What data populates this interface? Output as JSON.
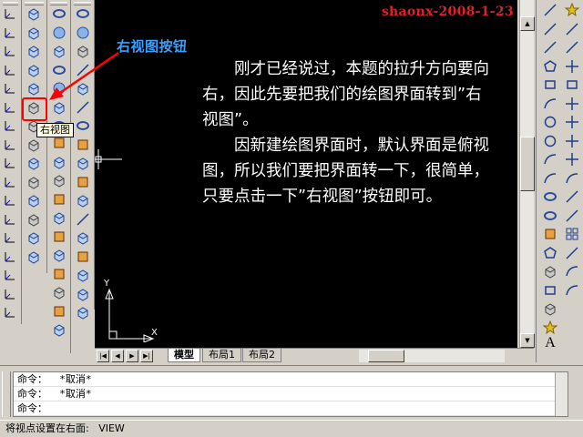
{
  "watermark": "shaonx-2008-1-23",
  "annotation": {
    "callout_label": "右视图按钮",
    "tooltip": "右视图",
    "colors": {
      "highlight": "#ff0000",
      "callout_text": "#3ca0ff",
      "arrow": "#ff0000"
    }
  },
  "explanation": {
    "paragraphs": [
      "刚才已经说过，本题的拉升方向要向右，因此先要把我们的绘图界面转到”右视图”。",
      "因新建绘图界面时，默认界面是俯视图，所以我们要把界面转一下，很简单，只要点击一下”右视图”按钮即可。"
    ]
  },
  "ucs": {
    "x_label": "X",
    "y_label": "Y"
  },
  "layout_tabs": [
    {
      "label": "模型",
      "active": true
    },
    {
      "label": "布局1",
      "active": false
    },
    {
      "label": "布局2",
      "active": false
    }
  ],
  "nav_buttons": [
    "|◀",
    "◀",
    "▶",
    "▶|"
  ],
  "command_window": {
    "lines": [
      "命令：  *取消*",
      "命令：  *取消*",
      "命令："
    ]
  },
  "status_bar": "将视点设置在右面:   VIEW",
  "right_toolbar_letter": "A"
}
